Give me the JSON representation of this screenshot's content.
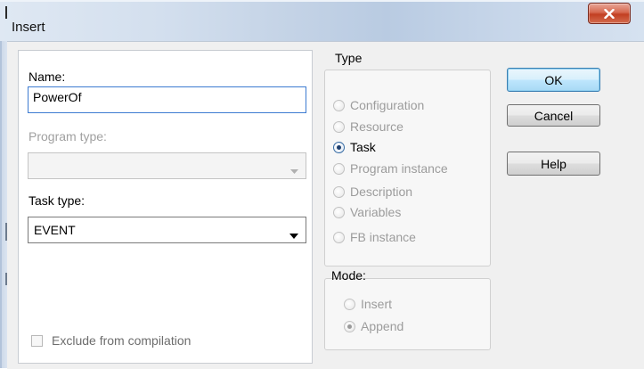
{
  "window": {
    "title": "Insert"
  },
  "form": {
    "name_label": "Name:",
    "name_value": "PowerOf",
    "program_type_label": "Program type:",
    "program_type_value": "",
    "task_type_label": "Task type:",
    "task_type_value": "EVENT",
    "exclude_label": "Exclude from compilation",
    "exclude_checked": false
  },
  "type_group": {
    "title": "Type",
    "options": [
      {
        "label": "Configuration",
        "selected": false,
        "enabled": false
      },
      {
        "label": "Resource",
        "selected": false,
        "enabled": false
      },
      {
        "label": "Task",
        "selected": true,
        "enabled": true
      },
      {
        "label": "Program instance",
        "selected": false,
        "enabled": false
      },
      {
        "label": "Description",
        "selected": false,
        "enabled": false
      },
      {
        "label": "Variables",
        "selected": false,
        "enabled": false
      },
      {
        "label": "FB instance",
        "selected": false,
        "enabled": false
      }
    ]
  },
  "mode_group": {
    "title": "Mode:",
    "options": [
      {
        "label": "Insert",
        "selected": false,
        "enabled": false
      },
      {
        "label": "Append",
        "selected": true,
        "enabled": false
      }
    ]
  },
  "buttons": {
    "ok": "OK",
    "cancel": "Cancel",
    "help": "Help"
  },
  "icons": {
    "close": "close-icon",
    "dropdown": "chevron-down-icon"
  },
  "colors": {
    "close_button": "#c23f22",
    "default_button_border": "#3c7fb1",
    "disabled_text": "#a0a0a0"
  }
}
